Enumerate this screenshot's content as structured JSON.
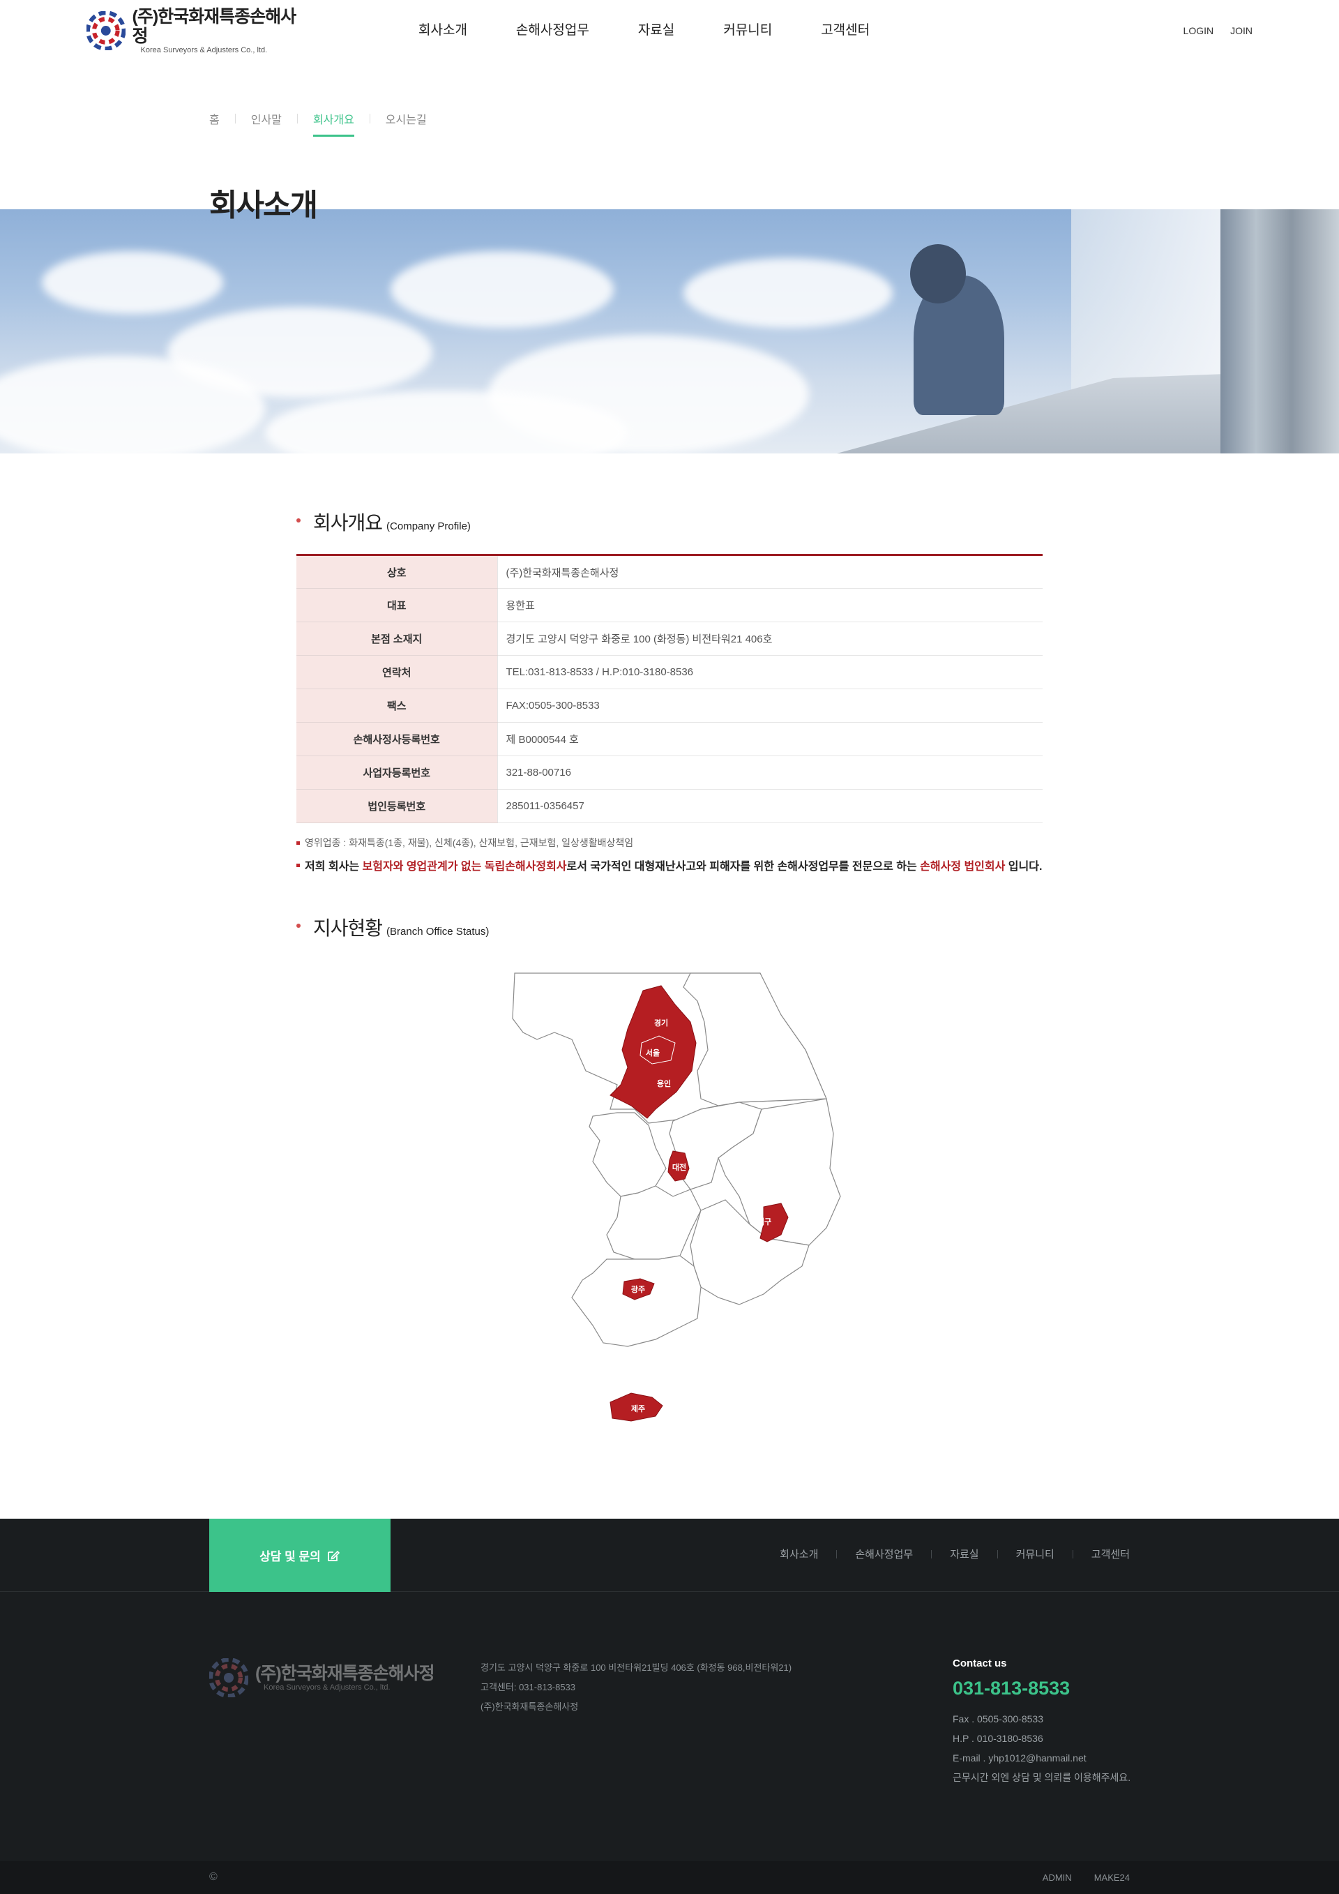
{
  "header": {
    "logo_ko": "(주)한국화재특종손해사정",
    "logo_en": "Korea Surveyors & Adjusters Co., ltd.",
    "gnb": [
      "회사소개",
      "손해사정업무",
      "자료실",
      "커뮤니티",
      "고객센터"
    ],
    "util": [
      "LOGIN",
      "JOIN"
    ]
  },
  "subnav": [
    "홈",
    "인사말",
    "회사개요",
    "오시는길"
  ],
  "page_title": "회사소개",
  "profile": {
    "title_ko": "회사개요",
    "title_en": "(Company Profile)",
    "rows": [
      {
        "label": "상호",
        "value": "(주)한국화재특종손해사정"
      },
      {
        "label": "대표",
        "value": "용한표"
      },
      {
        "label": "본점 소재지",
        "value": "경기도 고양시 덕양구 화중로 100 (화정동) 비전타워21 406호"
      },
      {
        "label": "연락처",
        "value": "TEL:031-813-8533 / H.P:010-3180-8536"
      },
      {
        "label": "팩스",
        "value": "FAX:0505-300-8533"
      },
      {
        "label": "손해사정사등록번호",
        "value": "제 B0000544 호"
      },
      {
        "label": "사업자등록번호",
        "value": "321-88-00716"
      },
      {
        "label": "법인등록번호",
        "value": "285011-0356457"
      }
    ],
    "note1": "영위업종 : 화재특종(1종, 재물), 신체(4종), 산재보험, 근재보험, 일상생활배상책임",
    "note2_a": "저희 회사는 ",
    "note2_b": "보험자와 영업관계가 없는 독립손해사정회사",
    "note2_c": "로서 국가적인 대형재난사고와 피해자를 위한 손해사정업무를 전문으로 하는 ",
    "note2_d": "손해사정 법인회사",
    "note2_e": " 입니다."
  },
  "branch": {
    "title_ko": "지사현황",
    "title_en": "(Branch Office Status)",
    "regions": [
      "경기",
      "서울",
      "용인",
      "대전",
      "대구",
      "광주",
      "제주"
    ]
  },
  "footer": {
    "consult": "상담 및 문의",
    "nav": [
      "회사소개",
      "손해사정업무",
      "자료실",
      "커뮤니티",
      "고객센터"
    ],
    "logo_ko": "(주)한국화재특종손해사정",
    "logo_en": "Korea Surveyors & Adjusters Co., ltd.",
    "address": [
      "경기도 고양시 덕양구 화중로 100 비전타워21빌딩 406호 (화정동 968,비전타워21)",
      "고객센터: 031-813-8533",
      "(주)한국화재특종손해사정"
    ],
    "contact_title": "Contact us",
    "contact_phone": "031-813-8533",
    "contact_lines": [
      "Fax . 0505-300-8533",
      "H.P . 010-3180-8536",
      "E-mail . yhp1012@hanmail.net",
      "근무시간 외엔 상담 및 의뢰를 이용해주세요."
    ],
    "copyright": "©",
    "bottom_links": [
      "ADMIN",
      "MAKE24"
    ]
  },
  "colors": {
    "accent_green": "#3cc38a",
    "accent_red": "#b12025",
    "region_fill": "#b51e22"
  }
}
